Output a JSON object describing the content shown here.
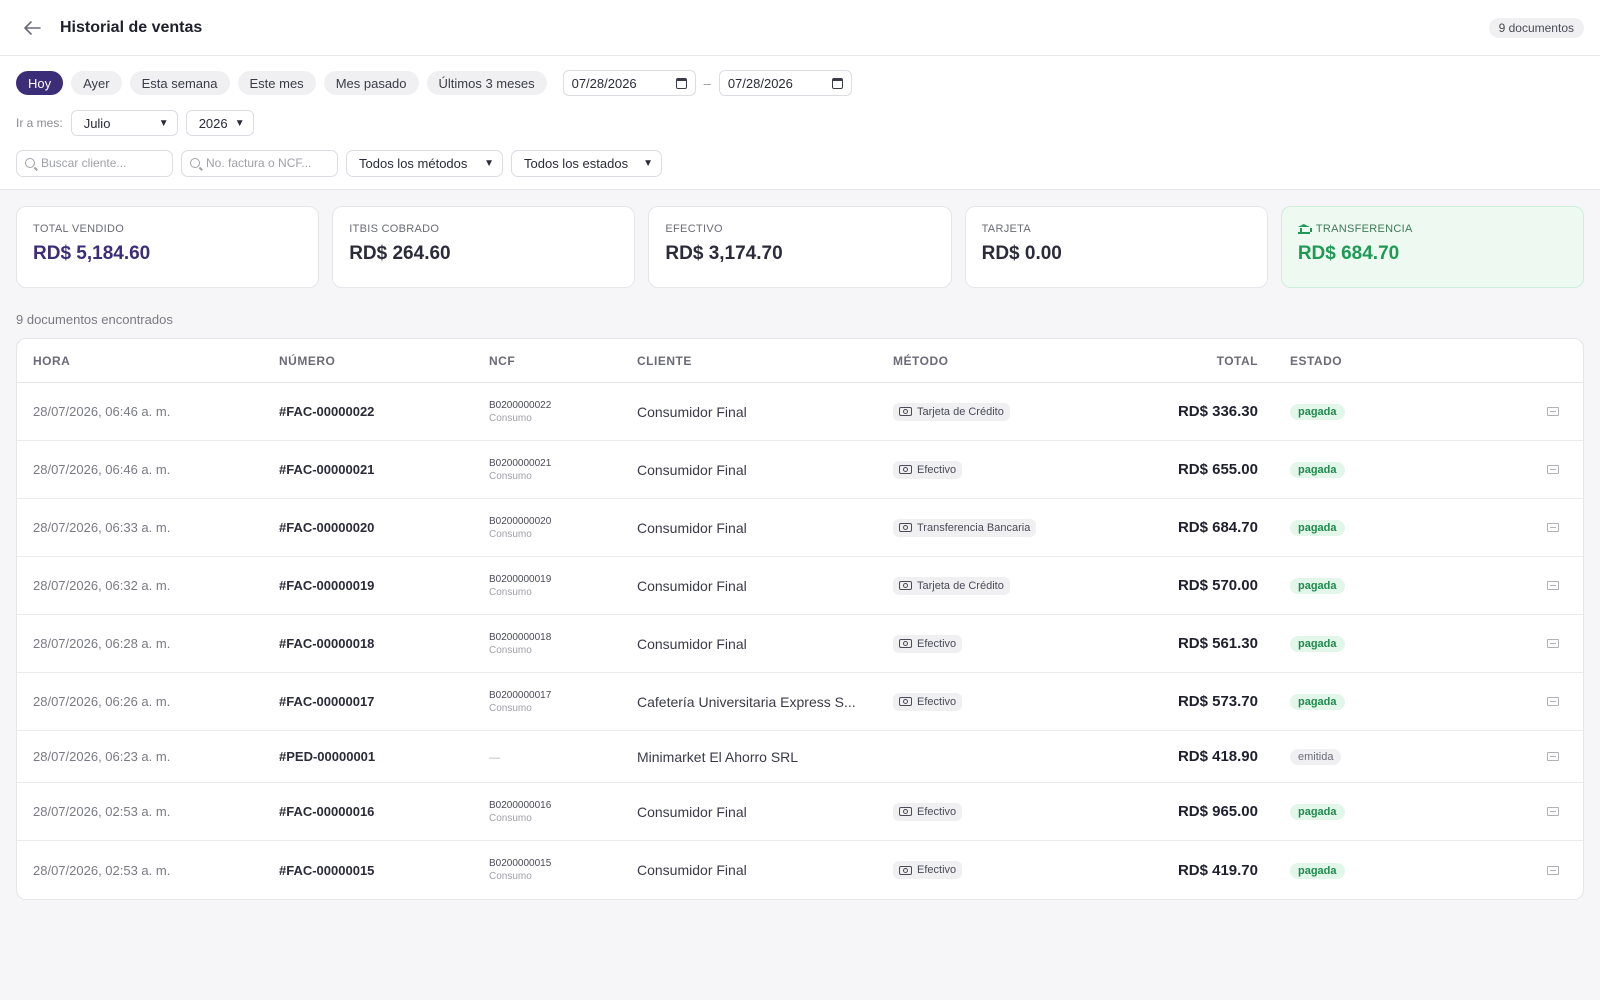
{
  "header": {
    "title": "Historial de ventas",
    "doc_count": "9 documentos"
  },
  "filters": {
    "quick_ranges": [
      "Hoy",
      "Ayer",
      "Esta semana",
      "Este mes",
      "Mes pasado",
      "Últimos 3 meses"
    ],
    "active_range": "Hoy",
    "date_from": "07/28/2026",
    "date_separator": "–",
    "date_to": "07/28/2026",
    "goto_label": "Ir a mes:",
    "month": "Julio",
    "year": "2026",
    "client_search_placeholder": "Buscar cliente...",
    "invoice_search_placeholder": "No. factura o NCF...",
    "method_filter": "Todos los métodos",
    "status_filter": "Todos los estados"
  },
  "summary": {
    "total_label": "TOTAL VENDIDO",
    "total_value": "RD$ 5,184.60",
    "itbis_label": "ITBIS COBRADO",
    "itbis_value": "RD$ 264.60",
    "cash_label": "EFECTIVO",
    "cash_value": "RD$ 3,174.70",
    "card_label": "TARJETA",
    "card_value": "RD$ 0.00",
    "transfer_label": "TRANSFERENCIA",
    "transfer_value": "RD$ 684.70",
    "colors": {
      "brand": "#3b2d78",
      "success": "#1f9a55"
    },
    "transfer_icon": "bank-icon"
  },
  "results_text": "9 documentos encontrados",
  "table": {
    "headers": {
      "hora": "HORA",
      "numero": "NÚMERO",
      "ncf": "NCF",
      "cliente": "CLIENTE",
      "metodo": "MÉTODO",
      "total": "TOTAL",
      "estado": "ESTADO"
    },
    "rows": [
      {
        "hora": "28/07/2026, 06:46 a. m.",
        "numero": "#FAC-00000022",
        "ncf": "B0200000022",
        "ncf_tipo": "Consumo",
        "cliente": "Consumidor Final",
        "metodo": "Tarjeta de Crédito",
        "total": "RD$ 336.30",
        "estado": "pagada"
      },
      {
        "hora": "28/07/2026, 06:46 a. m.",
        "numero": "#FAC-00000021",
        "ncf": "B0200000021",
        "ncf_tipo": "Consumo",
        "cliente": "Consumidor Final",
        "metodo": "Efectivo",
        "total": "RD$ 655.00",
        "estado": "pagada"
      },
      {
        "hora": "28/07/2026, 06:33 a. m.",
        "numero": "#FAC-00000020",
        "ncf": "B0200000020",
        "ncf_tipo": "Consumo",
        "cliente": "Consumidor Final",
        "metodo": "Transferencia Bancaria",
        "total": "RD$ 684.70",
        "estado": "pagada"
      },
      {
        "hora": "28/07/2026, 06:32 a. m.",
        "numero": "#FAC-00000019",
        "ncf": "B0200000019",
        "ncf_tipo": "Consumo",
        "cliente": "Consumidor Final",
        "metodo": "Tarjeta de Crédito",
        "total": "RD$ 570.00",
        "estado": "pagada"
      },
      {
        "hora": "28/07/2026, 06:28 a. m.",
        "numero": "#FAC-00000018",
        "ncf": "B0200000018",
        "ncf_tipo": "Consumo",
        "cliente": "Consumidor Final",
        "metodo": "Efectivo",
        "total": "RD$ 561.30",
        "estado": "pagada"
      },
      {
        "hora": "28/07/2026, 06:26 a. m.",
        "numero": "#FAC-00000017",
        "ncf": "B0200000017",
        "ncf_tipo": "Consumo",
        "cliente": "Cafetería Universitaria Express S...",
        "metodo": "Efectivo",
        "total": "RD$ 573.70",
        "estado": "pagada"
      },
      {
        "hora": "28/07/2026, 06:23 a. m.",
        "numero": "#PED-00000001",
        "ncf": "",
        "ncf_tipo": "",
        "ncf_empty": "—",
        "cliente": "Minimarket El Ahorro SRL",
        "metodo": "",
        "total": "RD$ 418.90",
        "estado": "emitida"
      },
      {
        "hora": "28/07/2026, 02:53 a. m.",
        "numero": "#FAC-00000016",
        "ncf": "B0200000016",
        "ncf_tipo": "Consumo",
        "cliente": "Consumidor Final",
        "metodo": "Efectivo",
        "total": "RD$ 965.00",
        "estado": "pagada"
      },
      {
        "hora": "28/07/2026, 02:53 a. m.",
        "numero": "#FAC-00000015",
        "ncf": "B0200000015",
        "ncf_tipo": "Consumo",
        "cliente": "Consumidor Final",
        "metodo": "Efectivo",
        "total": "RD$ 419.70",
        "estado": "pagada"
      }
    ]
  }
}
